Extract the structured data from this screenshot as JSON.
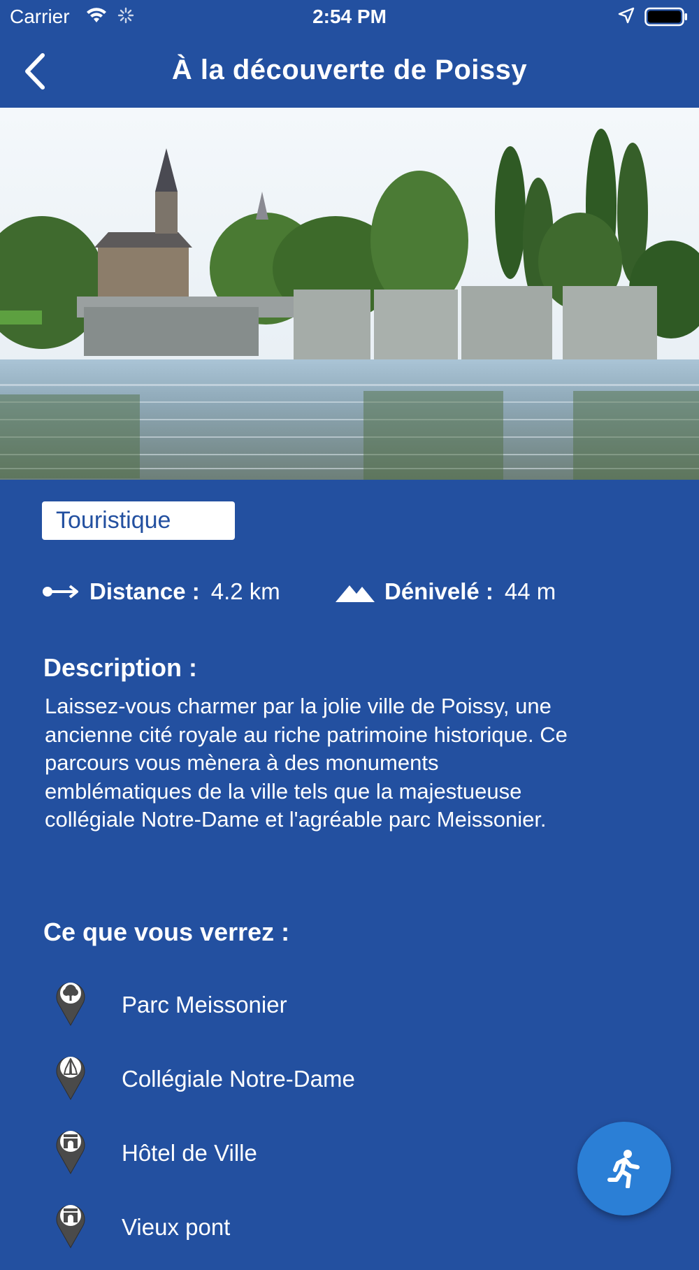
{
  "status_bar": {
    "carrier": "Carrier",
    "time": "2:54 PM"
  },
  "nav": {
    "title": "À la découverte de Poissy",
    "back_icon": "chevron-left-icon"
  },
  "hero": {
    "image_icon": "landscape-photo"
  },
  "category": "Touristique",
  "stats": {
    "distance_label": "Distance :",
    "distance_value": "4.2 km",
    "elevation_label": "Dénivelé :",
    "elevation_value": "44 m"
  },
  "description": {
    "title": "Description :",
    "text": "Laissez-vous charmer par la jolie ville de Poissy, une ancienne cité royale au riche patrimoine historique. Ce parcours vous mènera à des monuments emblématiques de la ville tels que la majestueuse collégiale Notre-Dame et l'agréable parc Meissonier."
  },
  "poi": {
    "title": "Ce que vous verrez :",
    "items": [
      {
        "label": "Parc Meissonier",
        "icon": "tree-pin-icon"
      },
      {
        "label": "Collégiale Notre-Dame",
        "icon": "praying-hands-pin-icon"
      },
      {
        "label": "Hôtel de Ville",
        "icon": "monument-pin-icon"
      },
      {
        "label": "Vieux pont",
        "icon": "monument-pin-icon"
      }
    ]
  },
  "fab": {
    "icon": "running-person-icon"
  },
  "colors": {
    "background": "#2350a0",
    "fab": "#2b7fd6",
    "chip_text": "#2350a0",
    "pin": "#4a4a4a"
  }
}
